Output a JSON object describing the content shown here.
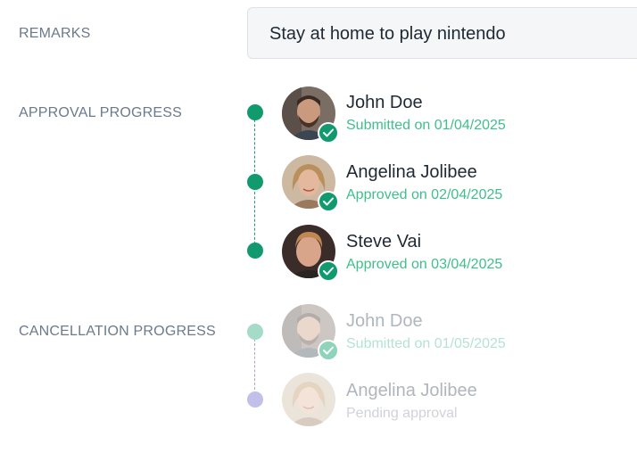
{
  "remarks": {
    "label": "REMARKS",
    "value": "Stay at home to play nintendo"
  },
  "approval": {
    "label": "APPROVAL PROGRESS",
    "steps": [
      {
        "name": "John Doe",
        "status": "Submitted on 01/04/2025",
        "state": "done"
      },
      {
        "name": "Angelina Jolibee",
        "status": "Approved on 02/04/2025",
        "state": "done"
      },
      {
        "name": "Steve Vai",
        "status": "Approved on 03/04/2025",
        "state": "done"
      }
    ]
  },
  "cancellation": {
    "label": "CANCELLATION PROGRESS",
    "steps": [
      {
        "name": "John Doe",
        "status": "Submitted on 01/05/2025",
        "state": "done"
      },
      {
        "name": "Angelina Jolibee",
        "status": "Pending approval",
        "state": "pending"
      }
    ]
  },
  "colors": {
    "accent_green": "#119a6e",
    "status_green": "#3fbf8c",
    "pending_purple": "#c2bfe9",
    "label_grey": "#6b7a8c"
  },
  "icons": {
    "badge": "check-icon",
    "timeline": "step-dot"
  }
}
